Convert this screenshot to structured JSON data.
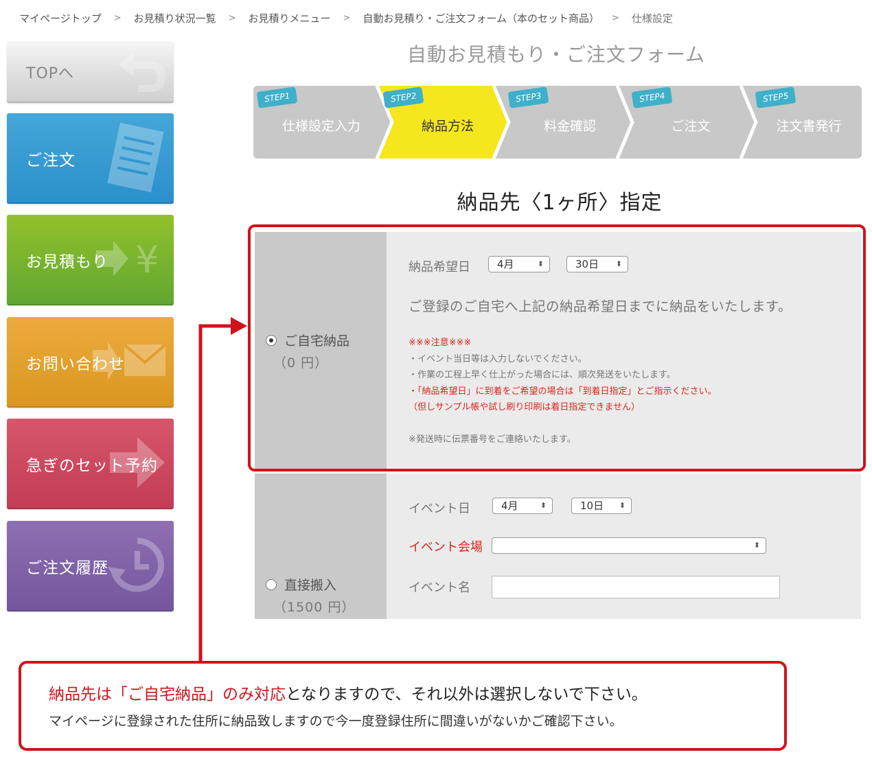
{
  "breadcrumb": [
    {
      "label": "マイページトップ"
    },
    {
      "label": "お見積り状況一覧"
    },
    {
      "label": "お見積りメニュー"
    },
    {
      "label": "自動お見積り・ご注文フォーム（本のセット商品）"
    },
    {
      "label": "仕様設定"
    }
  ],
  "breadcrumb_separator": ">",
  "sidebar": {
    "top": "TOPへ",
    "order": "ご注文",
    "quote": "お見積もり",
    "contact": "お問い合わせ",
    "rush": "急ぎのセット予約",
    "history": "ご注文履歴",
    "yen_symbol": "¥"
  },
  "form_title": "自動お見積もり・ご注文フォーム",
  "steps": [
    {
      "badge": "STEP1",
      "label": "仕様設定入力",
      "active": false
    },
    {
      "badge": "STEP2",
      "label": "納品方法",
      "active": true
    },
    {
      "badge": "STEP3",
      "label": "料金確認",
      "active": false
    },
    {
      "badge": "STEP4",
      "label": "ご注文",
      "active": false
    },
    {
      "badge": "STEP5",
      "label": "注文書発行",
      "active": false
    }
  ],
  "section_title": "納品先〈1ヶ所〉指定",
  "home_delivery": {
    "name": "ご自宅納品",
    "price": "（0 円）",
    "selected": true,
    "date_label": "納品希望日",
    "month": "4月",
    "day": "30日",
    "description": "ご登録のご自宅へ上記の納品希望日までに納品をいたします。",
    "notes": {
      "heading": "※※※注意※※※",
      "line1": "・イベント当日等は入力しないでください。",
      "line2": "・作業の工程上早く仕上がった場合には、順次発送をいたします。",
      "line3": "・「納品希望日」に到着をご希望の場合は「到着日指定」とご指示ください。",
      "line4": "（但しサンプル帳や試し刷り印刷は着日指定できません）",
      "line5": "※発送時に伝票番号をご連絡いたします。"
    }
  },
  "direct_delivery": {
    "name": "直接搬入",
    "price": "（1500 円）",
    "selected": false,
    "event_date_label": "イベント日",
    "month": "4月",
    "day": "10日",
    "venue_label": "イベント会場",
    "venue_value": "",
    "event_name_label": "イベント名",
    "event_name_value": ""
  },
  "notice": {
    "line1_red": "納品先は「ご自宅納品」のみ対応",
    "line1_rest": "となりますので、それ以外は選択しないで下さい。",
    "line2": "マイページに登録された住所に納品致しますので今一度登録住所に間違いがないかご確認下さい。"
  },
  "colors": {
    "accent_red": "#d2121b",
    "step_active": "#f5e61e",
    "step_inactive": "#c8c8c8",
    "step_badge": "#3fb0c9"
  }
}
